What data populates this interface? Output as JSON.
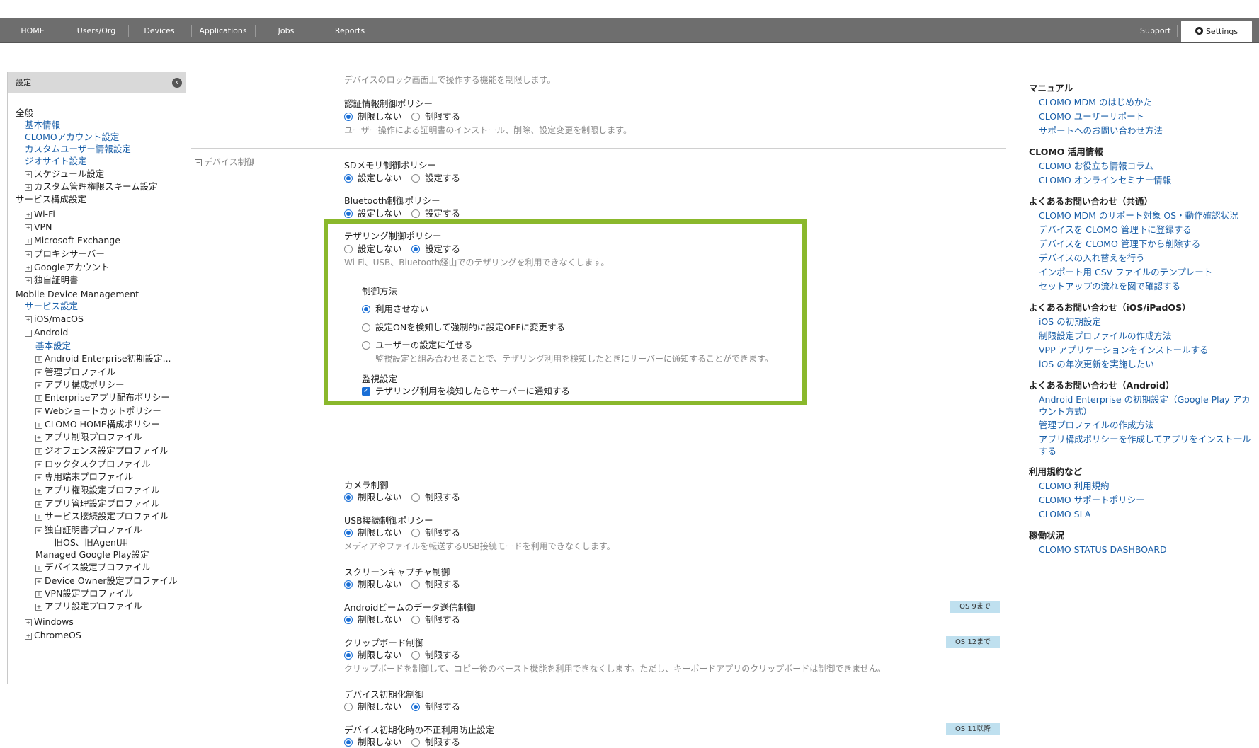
{
  "nav": {
    "items": [
      "HOME",
      "Users/Org",
      "Devices",
      "Applications",
      "Jobs",
      "Reports"
    ],
    "support": "Support",
    "settings": "Settings"
  },
  "sidebar": {
    "title": "設定",
    "lines": [
      {
        "t": "全般",
        "k": "txt",
        "i": 0,
        "p": ""
      },
      {
        "t": "基本情報",
        "k": "link",
        "i": 1,
        "p": ""
      },
      {
        "t": "CLOMOアカウント設定",
        "k": "link",
        "i": 1,
        "p": ""
      },
      {
        "t": "カスタムユーザー情報設定",
        "k": "link",
        "i": 1,
        "p": ""
      },
      {
        "t": "ジオサイト設定",
        "k": "link",
        "i": 1,
        "p": ""
      },
      {
        "t": "スケジュール設定",
        "k": "txt",
        "i": 1,
        "p": "+"
      },
      {
        "t": "カスタム管理権限スキーム設定",
        "k": "txt",
        "i": 1,
        "p": "+"
      },
      {
        "t": "サービス構成設定",
        "k": "txt",
        "i": 0,
        "p": ""
      },
      {
        "t": "Wi-Fi",
        "k": "txt",
        "i": 1,
        "p": "+"
      },
      {
        "t": "VPN",
        "k": "txt",
        "i": 1,
        "p": "+"
      },
      {
        "t": "Microsoft Exchange",
        "k": "txt",
        "i": 1,
        "p": "+"
      },
      {
        "t": "プロキシサーバー",
        "k": "txt",
        "i": 1,
        "p": "+"
      },
      {
        "t": "Googleアカウント",
        "k": "txt",
        "i": 1,
        "p": "+"
      },
      {
        "t": "独自証明書",
        "k": "txt",
        "i": 1,
        "p": "+"
      },
      {
        "t": "Mobile Device Management",
        "k": "txt",
        "i": 0,
        "p": ""
      },
      {
        "t": "サービス設定",
        "k": "link",
        "i": 1,
        "p": ""
      },
      {
        "t": "iOS/macOS",
        "k": "txt",
        "i": 1,
        "p": "+"
      },
      {
        "t": "Android",
        "k": "txt",
        "i": 1,
        "p": "-"
      },
      {
        "t": "基本設定",
        "k": "link",
        "i": 2,
        "p": ""
      },
      {
        "t": "Android Enterprise初期設定...",
        "k": "txt",
        "i": 2,
        "p": "+"
      },
      {
        "t": "管理プロファイル",
        "k": "txt",
        "i": 2,
        "p": "+"
      },
      {
        "t": "アプリ構成ポリシー",
        "k": "txt",
        "i": 2,
        "p": "+"
      },
      {
        "t": "Enterpriseアプリ配布ポリシー",
        "k": "txt",
        "i": 2,
        "p": "+"
      },
      {
        "t": "Webショートカットポリシー",
        "k": "txt",
        "i": 2,
        "p": "+"
      },
      {
        "t": "CLOMO HOME構成ポリシー",
        "k": "txt",
        "i": 2,
        "p": "+"
      },
      {
        "t": "アプリ制限プロファイル",
        "k": "txt",
        "i": 2,
        "p": "+"
      },
      {
        "t": "ジオフェンス設定プロファイル",
        "k": "txt",
        "i": 2,
        "p": "+"
      },
      {
        "t": "ロックタスクプロファイル",
        "k": "txt",
        "i": 2,
        "p": "+"
      },
      {
        "t": "専用端末プロファイル",
        "k": "txt",
        "i": 2,
        "p": "+"
      },
      {
        "t": "アプリ権限設定プロファイル",
        "k": "txt",
        "i": 2,
        "p": "+"
      },
      {
        "t": "アプリ管理設定プロファイル",
        "k": "txt",
        "i": 2,
        "p": "+"
      },
      {
        "t": "サービス接続設定プロファイル",
        "k": "txt",
        "i": 2,
        "p": "+"
      },
      {
        "t": "独自証明書プロファイル",
        "k": "txt",
        "i": 2,
        "p": "+"
      },
      {
        "t": "----- 旧OS、旧Agent用 -----",
        "k": "txt",
        "i": 2,
        "p": ""
      },
      {
        "t": "Managed Google Play設定",
        "k": "txt",
        "i": 2,
        "p": ""
      },
      {
        "t": "デバイス設定プロファイル",
        "k": "txt",
        "i": 2,
        "p": "+"
      },
      {
        "t": "Device Owner設定プロファイル",
        "k": "txt",
        "i": 2,
        "p": "+"
      },
      {
        "t": "VPN設定プロファイル",
        "k": "txt",
        "i": 2,
        "p": "+"
      },
      {
        "t": "アプリ設定プロファイル",
        "k": "txt",
        "i": 2,
        "p": "+"
      },
      {
        "t": "Windows",
        "k": "txt",
        "i": 1,
        "p": "+"
      },
      {
        "t": "ChromeOS",
        "k": "txt",
        "i": 1,
        "p": "+"
      }
    ]
  },
  "main": {
    "lockscreen_desc": "デバイスのロック画面上で操作する機能を制限します。",
    "section_label": "デバイス制御",
    "policies": [
      {
        "title": "認証情報制御ポリシー",
        "options": [
          "制限しない",
          "制限する"
        ],
        "selected": 0,
        "desc": "ユーザー操作による証明書のインストール、削除、設定変更を制限します。",
        "badge": ""
      },
      {
        "title": "SDメモリ制御ポリシー",
        "options": [
          "設定しない",
          "設定する"
        ],
        "selected": 0,
        "desc": "",
        "badge": ""
      },
      {
        "title": "Bluetooth制御ポリシー",
        "options": [
          "設定しない",
          "設定する"
        ],
        "selected": 0,
        "desc": "",
        "badge": ""
      },
      {
        "title": "テザリング制御ポリシー",
        "options": [
          "設定しない",
          "設定する"
        ],
        "selected": 1,
        "desc": "Wi-Fi、USB、Bluetooth経由でのテザリングを利用できなくします。",
        "badge": ""
      },
      {
        "title": "カメラ制御",
        "options": [
          "制限しない",
          "制限する"
        ],
        "selected": 0,
        "desc": "",
        "badge": ""
      },
      {
        "title": "USB接続制御ポリシー",
        "options": [
          "制限しない",
          "制限する"
        ],
        "selected": 0,
        "desc": "メディアやファイルを転送するUSB接続モードを利用できなくします。",
        "badge": ""
      },
      {
        "title": "スクリーンキャプチャ制御",
        "options": [
          "制限しない",
          "制限する"
        ],
        "selected": 0,
        "desc": "",
        "badge": ""
      },
      {
        "title": "Androidビームのデータ送信制御",
        "options": [
          "制限しない",
          "制限する"
        ],
        "selected": 0,
        "desc": "",
        "badge": "OS 9まで"
      },
      {
        "title": "クリップボード制御",
        "options": [
          "制限しない",
          "制限する"
        ],
        "selected": 0,
        "desc": "クリップボードを制御して、コピー後のペースト機能を利用できなくします。ただし、キーボードアプリのクリップボードは制御できません。",
        "badge": "OS 12まで"
      },
      {
        "title": "デバイス初期化制御",
        "options": [
          "制限しない",
          "制限する"
        ],
        "selected": 1,
        "desc": "",
        "badge": ""
      },
      {
        "title": "デバイス初期化時の不正利用防止設定",
        "options": [
          "制限しない",
          "制限する"
        ],
        "selected": 0,
        "desc": "",
        "badge": "OS 11以降"
      }
    ],
    "tethering": {
      "method_label": "制御方法",
      "methods": [
        "利用させない",
        "設定ONを検知して強制的に設定OFFに変更する",
        "ユーザーの設定に任せる"
      ],
      "method_selected": 0,
      "method_desc": "監視設定と組み合わせることで、テザリング利用を検知したときにサーバーに通知することができます。",
      "monitor_label": "監視設定",
      "monitor_option": "テザリング利用を検知したらサーバーに通知する",
      "monitor_checked": true
    }
  },
  "right": {
    "groups": [
      {
        "head": "マニュアル",
        "links": [
          "CLOMO MDM のはじめかた",
          "CLOMO ユーザーサポート",
          "サポートへのお問い合わせ方法"
        ]
      },
      {
        "head": "CLOMO 活用情報",
        "links": [
          "CLOMO お役立ち情報コラム",
          "CLOMO オンラインセミナー情報"
        ]
      },
      {
        "head": "よくあるお問い合わせ（共通）",
        "links": [
          "CLOMO MDM のサポート対象 OS・動作確認状況",
          "デバイスを CLOMO 管理下に登録する",
          "デバイスを CLOMO 管理下から削除する",
          "デバイスの入れ替えを行う",
          "インポート用 CSV ファイルのテンプレート",
          "セットアップの流れを図で確認する"
        ]
      },
      {
        "head": "よくあるお問い合わせ（iOS/iPadOS）",
        "links": [
          "iOS の初期設定",
          "制限設定プロファイルの作成方法",
          "VPP アプリケーションをインストールする",
          "iOS の年次更新を実施したい"
        ]
      },
      {
        "head": "よくあるお問い合わせ（Android）",
        "links": [
          "Android Enterprise の初期設定（Google Play ア|カウント方式）",
          "管理プロファイルの作成方法",
          "アプリ構成ポリシーを作成してアプリをインスト一|ルする"
        ]
      },
      {
        "head": "利用規約など",
        "links": [
          "CLOMO 利用規約",
          "CLOMO サポートポリシー",
          "CLOMO SLA"
        ]
      },
      {
        "head": "稼働状況",
        "links": [
          "CLOMO STATUS DASHBOARD"
        ]
      }
    ]
  }
}
